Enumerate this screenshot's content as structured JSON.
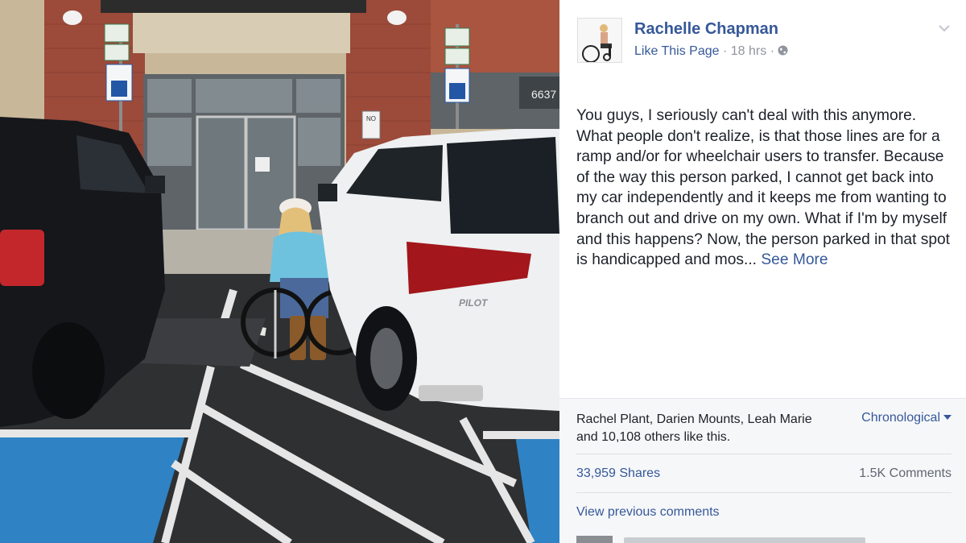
{
  "photo": {
    "store_number": "6637",
    "no_sign_text": "NO",
    "car_badge": "PILOT"
  },
  "post": {
    "author": "Rachelle Chapman",
    "like_page": "Like This Page",
    "time": "18 hrs",
    "separator": "·",
    "privacy_icon": "globe-icon",
    "menu_icon": "chevron-down-icon",
    "body": "You guys, I seriously can't deal with this anymore. What people don't realize, is that those lines are for a ramp and/or for wheelchair users to transfer. Because of the way this person parked, I cannot get back into my car independently and it keeps me from wanting to branch out and drive on my own. What if I'm by myself and this happens? Now, the person parked in that spot is handicapped and mos...",
    "see_more": "See More"
  },
  "footer": {
    "likes_text": "Rachel Plant, Darien Mounts, Leah Marie and 10,108 others like this.",
    "sort_label": "Chronological",
    "shares": "33,959 Shares",
    "comments": "1.5K Comments",
    "view_previous": "View previous comments"
  },
  "colors": {
    "link": "#365899",
    "muted": "#90949c",
    "footer_bg": "#f6f7f9",
    "parking_blue": "#2f83c4"
  }
}
